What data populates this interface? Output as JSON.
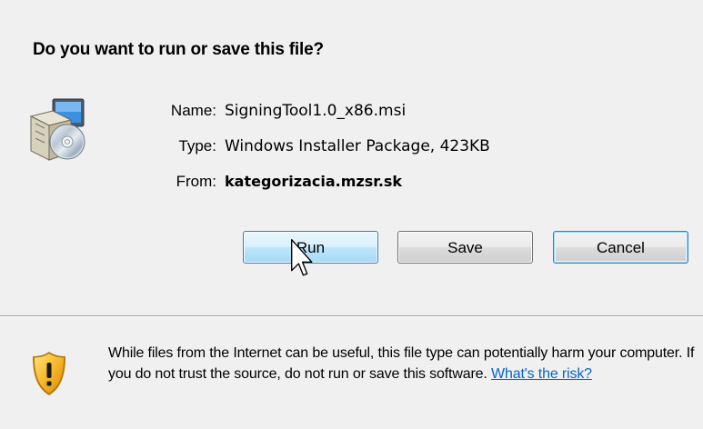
{
  "dialog": {
    "question": "Do you want to run or save this file?",
    "file": {
      "name_label": "Name:",
      "name_value": "SigningTool1.0_x86.msi",
      "type_label": "Type:",
      "type_value": "Windows Installer Package, 423KB",
      "from_label": "From:",
      "from_value": "kategorizacia.mzsr.sk",
      "icon": "installer-package-icon"
    },
    "buttons": {
      "run": "Run",
      "save": "Save",
      "cancel": "Cancel"
    },
    "warning": {
      "text": "While files from the Internet can be useful, this file type can potentially harm your computer. If you do not trust the source, do not run or save this software. ",
      "link": "What's the risk?",
      "icon": "security-shield-warning-icon"
    }
  }
}
